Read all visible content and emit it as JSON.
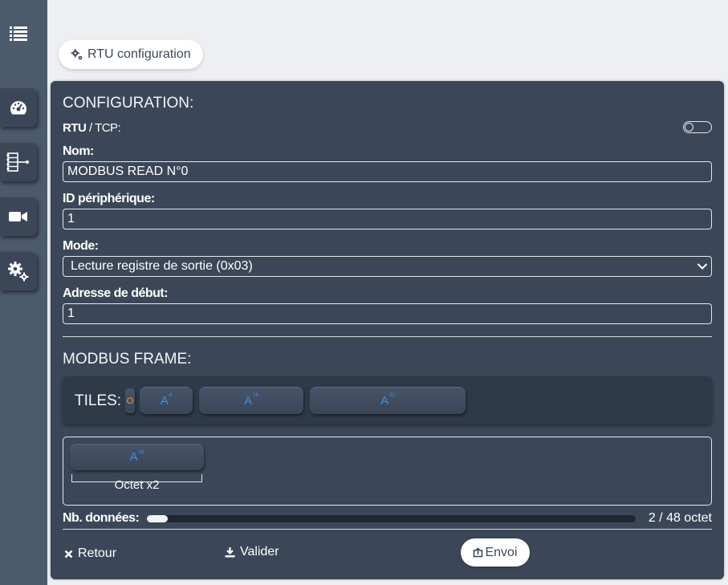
{
  "sidebar": {
    "menu_icon": "list-icon",
    "items": [
      {
        "icon": "dashboard-gauge-icon"
      },
      {
        "icon": "network-tree-icon"
      },
      {
        "icon": "video-camera-icon"
      },
      {
        "icon": "gears-icon"
      }
    ]
  },
  "top_pill": {
    "label": "RTU configuration",
    "icon": "gears-icon"
  },
  "config": {
    "heading": "CONFIGURATION:",
    "mode_toggle": {
      "rtu": "RTU",
      "separator": " / ",
      "tcp": "TCP:"
    },
    "nom": {
      "label": "Nom:",
      "value": "MODBUS READ N°0"
    },
    "device_id": {
      "label": "ID périphérique:",
      "value": "1"
    },
    "mode": {
      "label": "Mode:",
      "value": "Lecture registre de sortie (0x03)"
    },
    "start_address": {
      "label": "Adresse de début:",
      "value": "1"
    }
  },
  "frame": {
    "heading": "MODBUS FRAME:",
    "tiles_label": "TILES:",
    "mini_tile": "O",
    "tiles": [
      {
        "letter": "A",
        "sup": "8"
      },
      {
        "letter": "A",
        "sup": "16"
      },
      {
        "letter": "A",
        "sup": "32"
      }
    ],
    "frame_tile": {
      "letter": "A",
      "sup": "16"
    },
    "octet_label": "Octet x2"
  },
  "data_count": {
    "label": "Nb. données:",
    "progress": 0.0417,
    "value_text": "2 / 48 octet"
  },
  "actions": {
    "retour": "Retour",
    "valider": "Valider",
    "envoi": "Envoi"
  },
  "colors": {
    "panel": "#3b4758",
    "sidebar": "#4c5a6d",
    "accent_blue": "#3a8ee6",
    "accent_orange": "#f0a020"
  }
}
